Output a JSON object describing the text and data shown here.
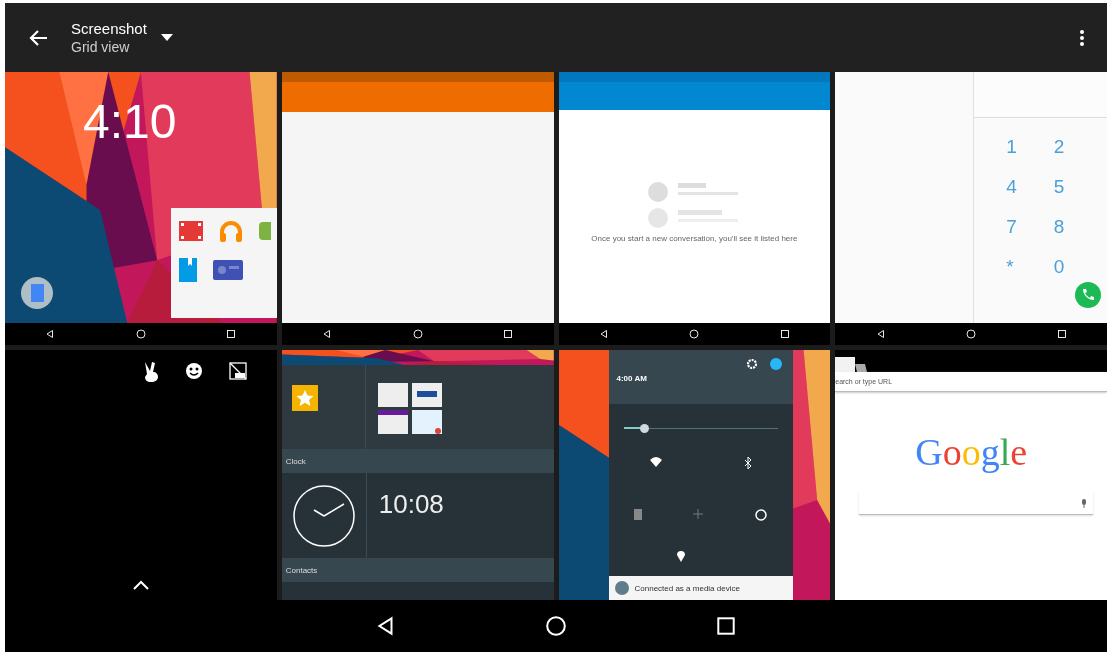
{
  "app_bar": {
    "title": "Screenshot",
    "subtitle": "Grid view"
  },
  "thumbnails": [
    {
      "kind": "lockscreen",
      "clock": "4:10"
    },
    {
      "kind": "orange_app"
    },
    {
      "kind": "messaging",
      "message": "Once you start a new conversation, you'll see it listed here"
    },
    {
      "kind": "dialer",
      "keys": [
        "1",
        "2",
        "4",
        "5",
        "7",
        "8",
        "*",
        "0"
      ]
    },
    {
      "kind": "black_toolbar"
    },
    {
      "kind": "widgets",
      "sections": [
        "Clock",
        "Contacts"
      ],
      "clock": "10:08"
    },
    {
      "kind": "quick_settings",
      "time": "4:00 AM",
      "brightness": {
        "level": 0.13
      },
      "notification": "Connected as a media device"
    },
    {
      "kind": "browser",
      "url_hint": "earch or type URL",
      "logo": "Google"
    }
  ]
}
